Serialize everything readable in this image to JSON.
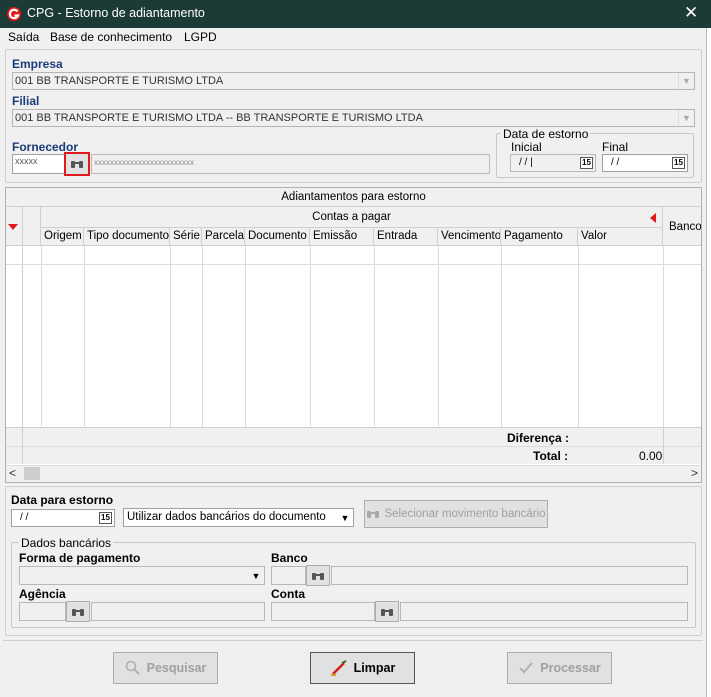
{
  "window": {
    "title": "CPG - Estorno de adiantamento",
    "close_glyph": "✕"
  },
  "menu": {
    "items": [
      "Saída",
      "Base de conhecimento",
      "LGPD"
    ]
  },
  "empresa": {
    "label": "Empresa",
    "value": "001 BB TRANSPORTE E TURISMO LTDA"
  },
  "filial": {
    "label": "Filial",
    "value": "001 BB TRANSPORTE E TURISMO LTDA -- BB TRANSPORTE E TURISMO LTDA"
  },
  "fornecedor": {
    "label": "Fornecedor",
    "code_value": "xxxxx",
    "name_value": "xxxxxxxxxxxxxxxxxxxxxxxxx"
  },
  "data_estorno": {
    "group_title": "Data de estorno",
    "inicial_label": "Inicial",
    "inicial_value": "/ /  |",
    "final_label": "Final",
    "final_value": "/ /",
    "cal_glyph": "15"
  },
  "grid": {
    "title": "Adiantamentos para estorno",
    "group_header": "Contas a pagar",
    "bancos_header": "Bancos",
    "columns": [
      "Origem",
      "Tipo documento",
      "Série",
      "Parcela",
      "Documento",
      "Emissão",
      "Entrada",
      "Vencimento",
      "Pagamento",
      "Valor"
    ],
    "diferenca_label": "Diferença :",
    "total_label": "Total :",
    "total_value": "0.00",
    "scroll_left": "<",
    "scroll_right": ">"
  },
  "data_para_estorno": {
    "label": "Data para estorno",
    "value": "/ /",
    "cal_glyph": "15",
    "option_selected": "Utilizar dados bancários do documento",
    "select_button": "Selecionar movimento bancário"
  },
  "dados_bancarios": {
    "group_title": "Dados bancários",
    "forma_pagamento_label": "Forma de pagamento",
    "banco_label": "Banco",
    "agencia_label": "Agência",
    "conta_label": "Conta"
  },
  "actions": {
    "pesquisar": "Pesquisar",
    "limpar": "Limpar",
    "processar": "Processar"
  },
  "colors": {
    "titlebar": "#1c3a36",
    "label_blue": "#1a3c7a",
    "highlight_red": "#e0191a"
  }
}
